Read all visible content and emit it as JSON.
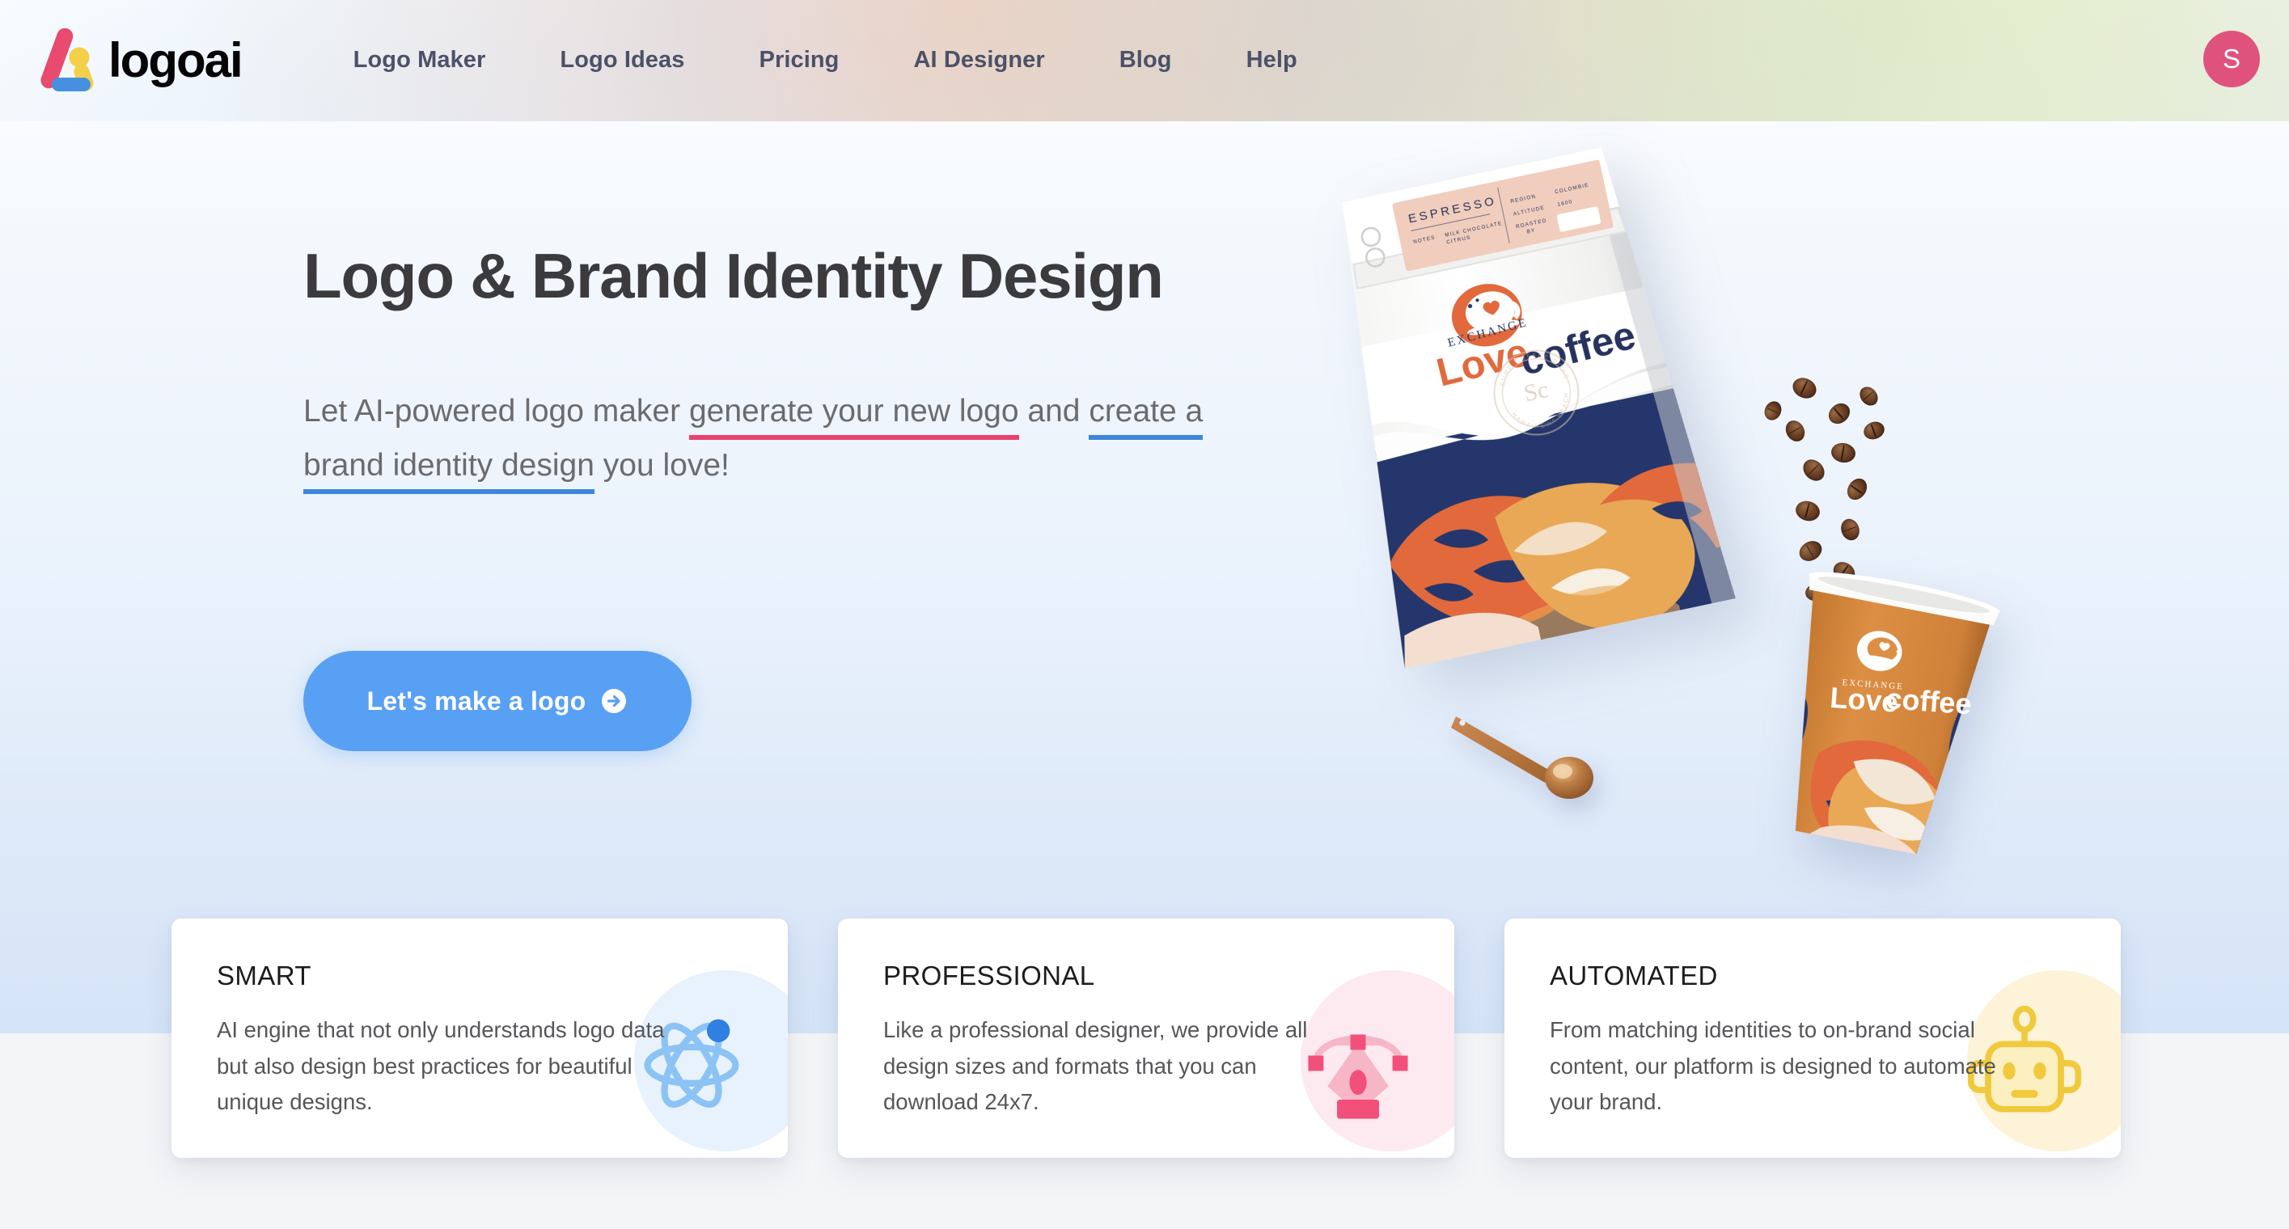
{
  "header": {
    "brand_name": "logoai",
    "brand_icon": "logoai-triangle-mark",
    "nav": [
      {
        "label": "Logo Maker"
      },
      {
        "label": "Logo Ideas"
      },
      {
        "label": "Pricing"
      },
      {
        "label": "AI Designer"
      },
      {
        "label": "Blog"
      },
      {
        "label": "Help"
      }
    ],
    "avatar_initial": "S",
    "avatar_color": "#e0527e"
  },
  "hero": {
    "headline": "Logo & Brand Identity Design",
    "sub_part1": "Let AI-powered logo maker ",
    "sub_highlight_pink": "generate your new logo",
    "sub_part2": " and ",
    "sub_highlight_blue": "create a brand identity design",
    "sub_part3": " you love!",
    "pink_underline_color": "#e8436e",
    "blue_underline_color": "#3d87d8",
    "cta_label": "Let's make a logo",
    "cta_icon": "arrow-right-circle-icon",
    "cta_color": "#58a0f4"
  },
  "mockup": {
    "alt": "coffee-brand-identity-mockup",
    "bag": {
      "label_title": "ESPRESSO",
      "notes_label": "NOTES",
      "notes_value_line1": "MILK CHOCOLATE",
      "notes_value_line2": "CITRUS",
      "field_region": "REGION",
      "field_altitude": "ALTITUDE",
      "field_roasted": "ROASTED",
      "field_roasted_by": "BY",
      "value_region": "COLOMBIE",
      "value_altitude": "1600",
      "brand_prefix": "EXCHANGE",
      "brand_bold": "Love",
      "brand_rest": "coffee",
      "seal_top": "SURF COFFEE ROASTERS",
      "seal_center": "Sc",
      "seal_bottom": "HAWAII EWA BEACH"
    },
    "cup": {
      "brand_prefix": "EXCHANGE",
      "brand_bold": "Love",
      "brand_rest": "coffee"
    },
    "colors": {
      "navy": "#24366b",
      "orange": "#e1693c",
      "amber": "#e9a855",
      "cream": "#f4ded0",
      "cup_body": "#d8883f"
    }
  },
  "features": [
    {
      "title": "SMART",
      "text": "AI engine that not only understands logo data but also design best practices for beautiful unique designs.",
      "icon": "atom-icon",
      "blob_color": "#e8f2fd",
      "icon_color": "#8cc3f5",
      "accent_color": "#2f80e0"
    },
    {
      "title": "PROFESSIONAL",
      "text": "Like a professional designer, we provide all design sizes and formats that you can download 24x7.",
      "icon": "pen-tool-icon",
      "blob_color": "#fdeaf0",
      "icon_color": "#f7b6c6",
      "accent_color": "#f2507b"
    },
    {
      "title": "AUTOMATED",
      "text": "From matching identities to on-brand social content, our platform is designed to automate your brand.",
      "icon": "robot-icon",
      "blob_color": "#fdf3d8",
      "icon_color": "#f6d866",
      "accent_color": "#f0c93c"
    }
  ]
}
